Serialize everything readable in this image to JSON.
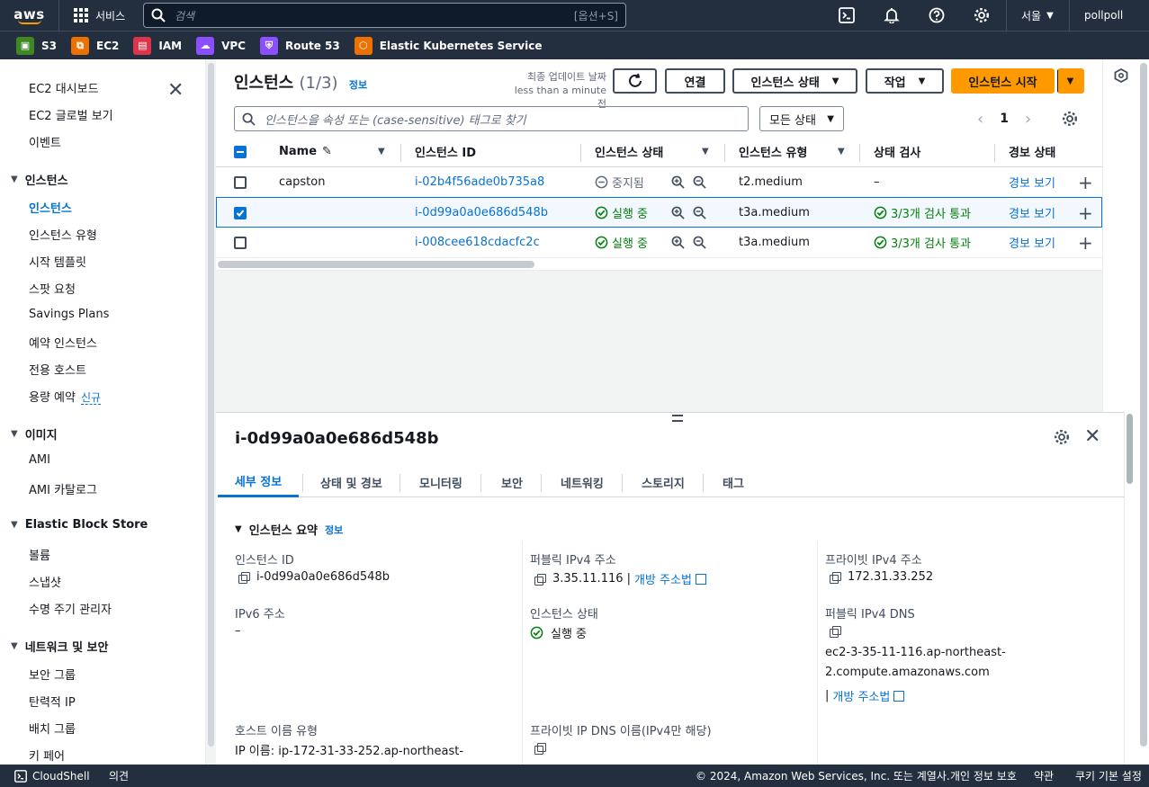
{
  "topnav": {
    "logo": "aws",
    "services_label": "서비스",
    "search_placeholder": "검색",
    "search_shortcut": "[옵션+S]",
    "region": "서울",
    "user": "pollpoll"
  },
  "favorites": [
    {
      "label": "S3",
      "color": "#3f8624",
      "icon": "s3-icon"
    },
    {
      "label": "EC2",
      "color": "#ed7100",
      "icon": "ec2-icon"
    },
    {
      "label": "IAM",
      "color": "#dd344c",
      "icon": "iam-icon"
    },
    {
      "label": "VPC",
      "color": "#8c4fff",
      "icon": "vpc-icon"
    },
    {
      "label": "Route 53",
      "color": "#8c4fff",
      "icon": "route53-icon"
    },
    {
      "label": "Elastic Kubernetes Service",
      "color": "#ed7100",
      "icon": "eks-icon"
    }
  ],
  "sidebar": {
    "top_items": [
      "EC2 대시보드",
      "EC2 글로벌 보기",
      "이벤트"
    ],
    "sections": [
      {
        "title": "인스턴스",
        "items": [
          "인스턴스",
          "인스턴스 유형",
          "시작 템플릿",
          "스팟 요청",
          "Savings Plans",
          "예약 인스턴스",
          "전용 호스트",
          "용량 예약"
        ]
      },
      {
        "title": "이미지",
        "items": [
          "AMI",
          "AMI 카탈로그"
        ]
      },
      {
        "title": "Elastic Block Store",
        "items": [
          "볼륨",
          "스냅샷",
          "수명 주기 관리자"
        ]
      },
      {
        "title": "네트워크 및 보안",
        "items": [
          "보안 그룹",
          "탄력적 IP",
          "배치 그룹",
          "키 페어"
        ]
      }
    ],
    "new_badge": "신규"
  },
  "instances": {
    "title": "인스턴스",
    "count": "(1/3)",
    "info": "정보",
    "updated_line1": "최종 업데이트 날짜",
    "updated_line2": "less than a minute 전",
    "btn_connect": "연결",
    "btn_state": "인스턴스 상태",
    "btn_actions": "작업",
    "btn_launch": "인스턴스 시작",
    "filter_placeholder": "인스턴스을 속성 또는 (case-sensitive) 태그로 찾기",
    "state_filter": "모든 상태",
    "page": "1",
    "columns": [
      "Name",
      "인스턴스 ID",
      "인스턴스 상태",
      "인스턴스 유형",
      "상태 검사",
      "경보 상태"
    ],
    "rows": [
      {
        "name": "capston",
        "id": "i-02b4f56ade0b735a8",
        "state": "중지됨",
        "running": false,
        "type": "t2.medium",
        "check": "–",
        "alarm": "경보 보기",
        "selected": false
      },
      {
        "name": "",
        "id": "i-0d99a0a0e686d548b",
        "state": "실행 중",
        "running": true,
        "type": "t3a.medium",
        "check": "3/3개 검사 통과",
        "alarm": "경보 보기",
        "selected": true
      },
      {
        "name": "",
        "id": "i-008cee618cdacfc2c",
        "state": "실행 중",
        "running": true,
        "type": "t3a.medium",
        "check": "3/3개 검사 통과",
        "alarm": "경보 보기",
        "selected": false
      }
    ]
  },
  "detail": {
    "title": "i-0d99a0a0e686d548b",
    "tabs": [
      "세부 정보",
      "상태 및 경보",
      "모니터링",
      "보안",
      "네트워킹",
      "스토리지",
      "태그"
    ],
    "section": "인스턴스 요약",
    "info": "정보",
    "fields": {
      "instance_id_label": "인스턴스 ID",
      "instance_id": "i-0d99a0a0e686d548b",
      "public_ipv4_label": "퍼블릭 IPv4 주소",
      "public_ipv4": "3.35.11.116",
      "open_address": "개방 주소법",
      "private_ipv4_label": "프라이빗 IPv4 주소",
      "private_ipv4": "172.31.33.252",
      "ipv6_label": "IPv6 주소",
      "ipv6": "–",
      "state_label": "인스턴스 상태",
      "state": "실행 중",
      "public_dns_label": "퍼블릭 IPv4 DNS",
      "public_dns_1": "ec2-3-35-11-116.ap-northeast-",
      "public_dns_2": "2.compute.amazonaws.com",
      "hostname_type_label": "호스트 이름 유형",
      "hostname_type": "IP 이름: ip-172-31-33-252.ap-northeast-",
      "private_dns_label": "프라이빗 IP DNS 이름(IPv4만 해당)"
    }
  },
  "footer": {
    "cloudshell": "CloudShell",
    "feedback": "의견",
    "copyright": "© 2024, Amazon Web Services, Inc. 또는 계열사.",
    "privacy": "개인 정보 보호",
    "terms": "약관",
    "cookies": "쿠키 기본 설정"
  }
}
